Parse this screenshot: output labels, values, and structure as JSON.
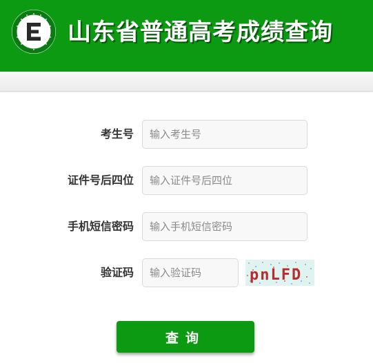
{
  "header": {
    "title": "山东省普通高考成绩查询",
    "bg_color": "#0b9a12",
    "logo_icon": "exam-authority-logo"
  },
  "form": {
    "fields": [
      {
        "label": "考生号",
        "placeholder": "输入考生号"
      },
      {
        "label": "证件号后四位",
        "placeholder": "输入证件号后四位"
      },
      {
        "label": "手机短信密码",
        "placeholder": "输入手机短信密码"
      },
      {
        "label": "验证码",
        "placeholder": "输入验证码"
      }
    ],
    "captcha_text": "pnLFD",
    "submit_label": "查询",
    "accent_color": "#0b9a12"
  }
}
